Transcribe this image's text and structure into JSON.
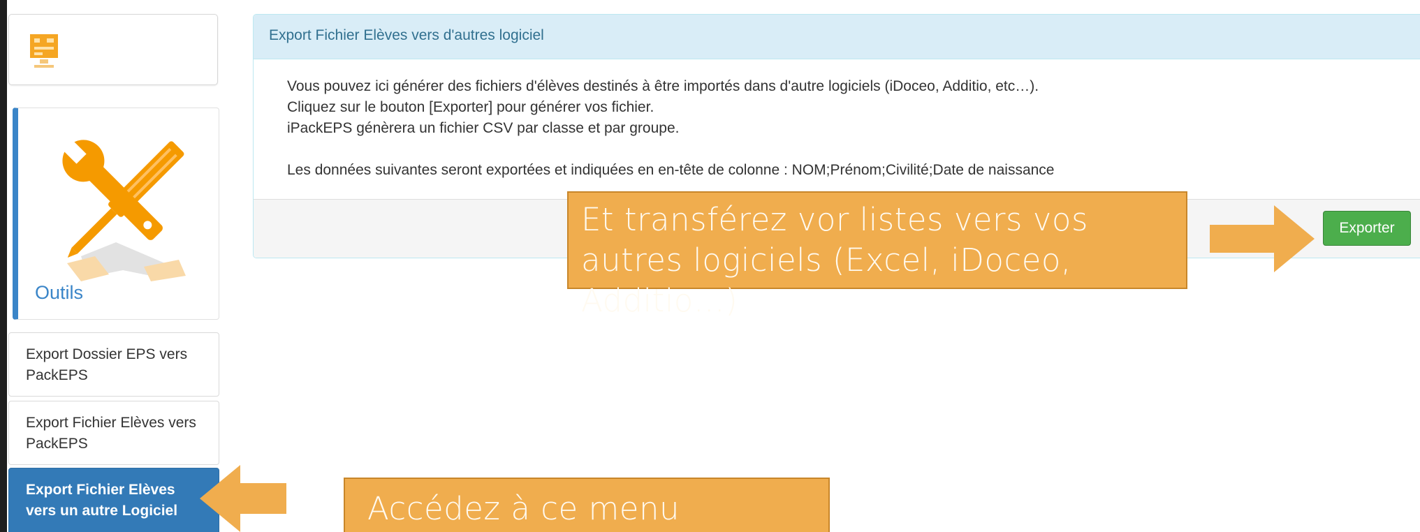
{
  "sidebar": {
    "logo_icon": "packeps-logo-icon",
    "tools_icon": "wrench-screwdriver-icon",
    "tools_title": "Outils",
    "items": [
      {
        "label": "Export Dossier EPS vers PackEPS",
        "active": false
      },
      {
        "label": "Export Fichier Elèves vers PackEPS",
        "active": false
      },
      {
        "label": "Export Fichier Elèves vers un autre Logiciel",
        "active": true
      }
    ]
  },
  "panel": {
    "title": "Export Fichier Elèves vers d'autres logiciel",
    "lines": [
      "Vous pouvez ici générer des fichiers d'élèves destinés à être importés dans d'autre logiciels (iDoceo, Additio, etc…).",
      "Cliquez sur le bouton [Exporter] pour générer vos fichier.",
      "iPackEPS génèrera un fichier CSV par classe et par groupe.",
      "Les données suivantes seront exportées et indiquées en en-tête de colonne : NOM;Prénom;Civilité;Date de naissance"
    ],
    "export_button": "Exporter"
  },
  "callouts": {
    "transfer": "Et transférez vor listes vers vos autres logiciels (Excel, iDoceo, Additio…)",
    "menu": "Accédez à ce menu"
  },
  "colors": {
    "accent": "#337ab7",
    "success": "#4cae4c",
    "callout": "#f0ad4e",
    "panel_heading": "#d9edf7"
  }
}
